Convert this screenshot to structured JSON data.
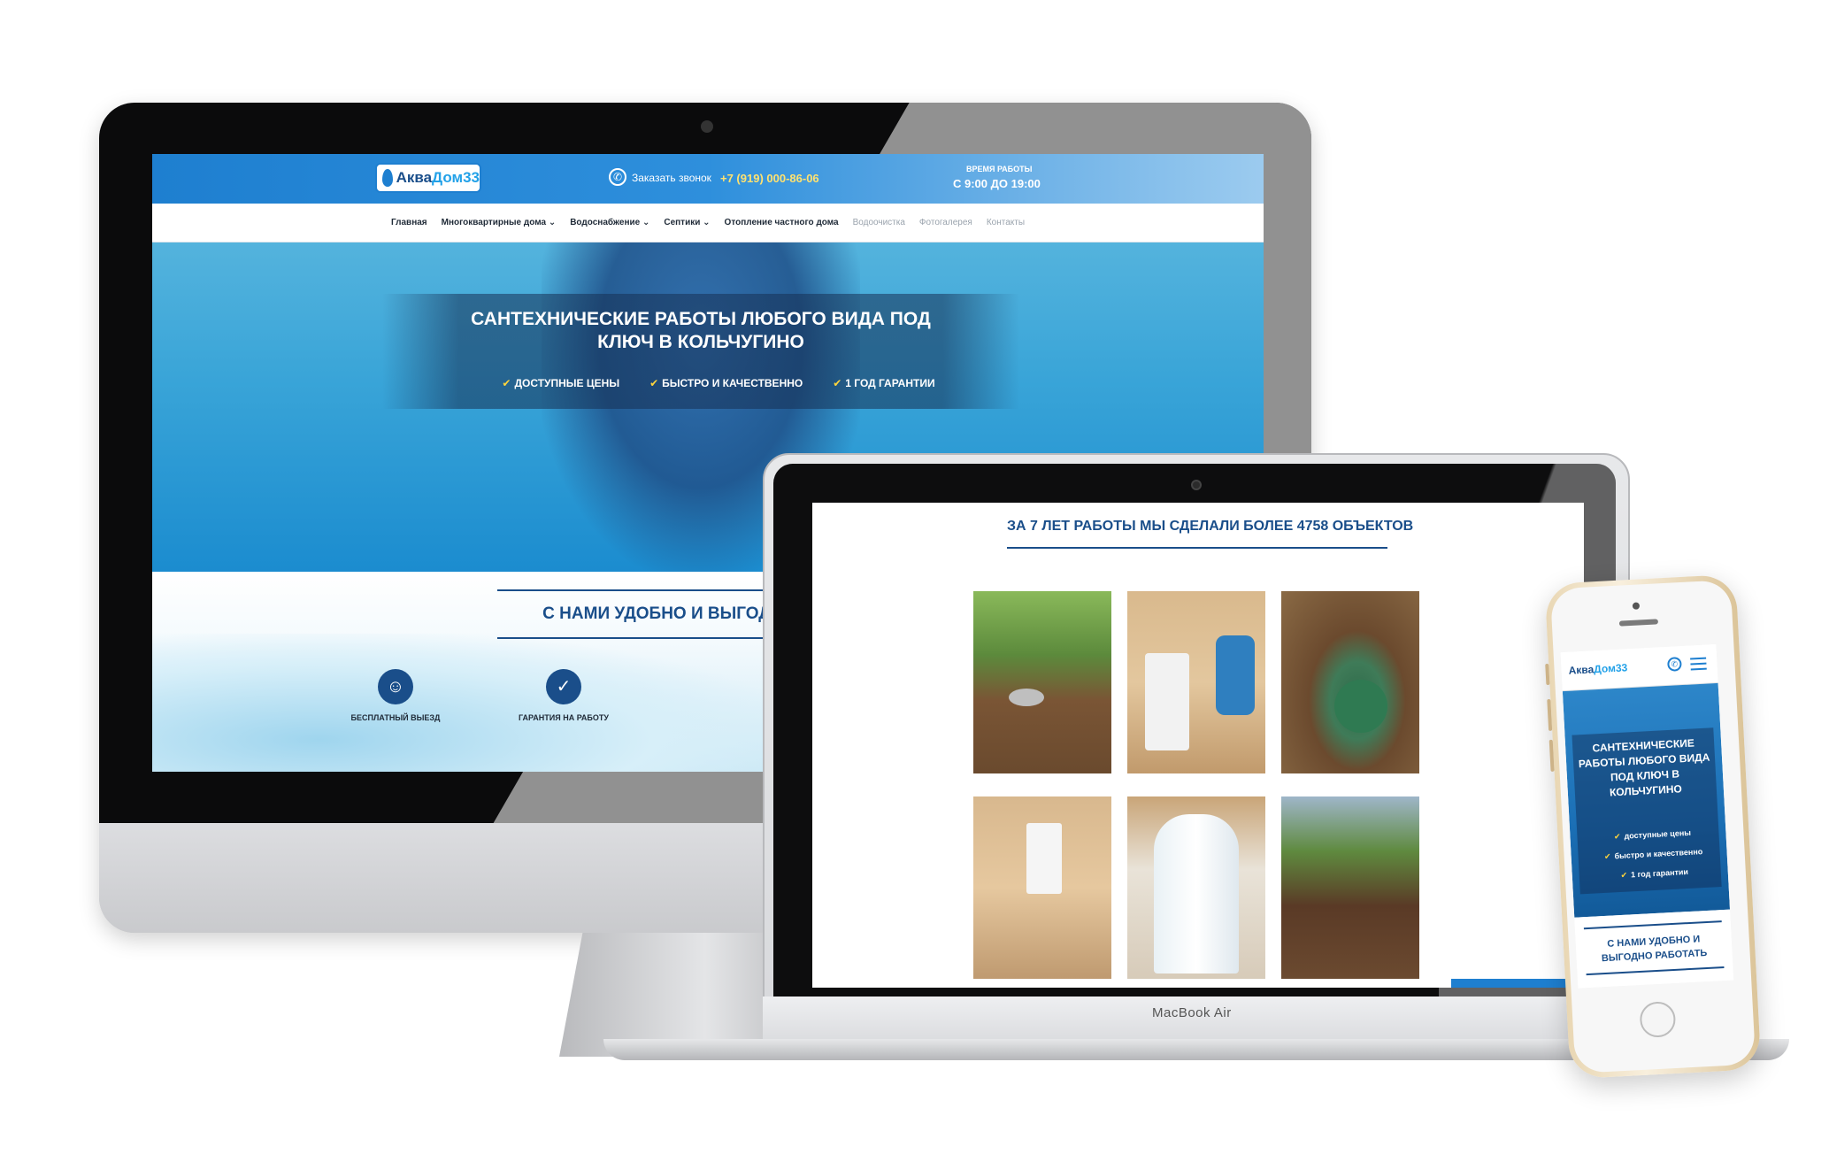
{
  "desktop": {
    "header": {
      "logo_text_a": "Аква",
      "logo_text_b": "Дом33",
      "call_label": "Заказать звонок",
      "phone": "+7 (919) 000-86-06",
      "hours_label": "ВРЕМЯ РАБОТЫ",
      "hours_value": "С 9:00 ДО 19:00"
    },
    "nav": {
      "items": [
        {
          "label": "Главная"
        },
        {
          "label": "Многоквартирные дома ⌄"
        },
        {
          "label": "Водоснабжение ⌄"
        },
        {
          "label": "Септики ⌄"
        },
        {
          "label": "Отопление частного дома"
        },
        {
          "label": "Водоочистка"
        },
        {
          "label": "Фотогалерея"
        },
        {
          "label": "Контакты"
        }
      ]
    },
    "hero": {
      "title": "САНТЕХНИЧЕСКИЕ РАБОТЫ ЛЮБОГО ВИДА ПОД КЛЮЧ В КОЛЬЧУГИНО",
      "features": [
        "ДОСТУПНЫЕ ЦЕНЫ",
        "БЫСТРО И КАЧЕСТВЕННО",
        "1 ГОД ГАРАНТИИ"
      ]
    },
    "benefits": {
      "title": "С НАМИ УДОБНО И ВЫГОД",
      "items": [
        {
          "label": "БЕСПЛАТНЫЙ ВЫЕЗД",
          "icon": "mechanic-icon"
        },
        {
          "label": "ГАРАНТИЯ НА РАБОТУ",
          "icon": "badge-check-icon"
        }
      ]
    }
  },
  "laptop": {
    "device_label": "MacBook Air",
    "objects_title": "ЗА 7 ЛЕТ РАБОТЫ МЫ СДЕЛАЛИ БОЛЕЕ 4758 ОБЪЕКТОВ"
  },
  "mobile": {
    "logo_text_a": "Аква",
    "logo_text_b": "Дом33",
    "hero_title": "САНТЕХНИЧЕСКИЕ РАБОТЫ ЛЮБОГО ВИДА ПОД КЛЮЧ В КОЛЬЧУГИНО",
    "features": [
      "доступные цены",
      "быстро и качественно",
      "1 год гарантии"
    ],
    "benefits_title": "С НАМИ УДОБНО И ВЫГОДНО РАБОТАТЬ"
  },
  "colors": {
    "brand_blue": "#1e7fd0",
    "dark_blue": "#1a4e8a",
    "accent_yellow": "#ffd53c"
  }
}
